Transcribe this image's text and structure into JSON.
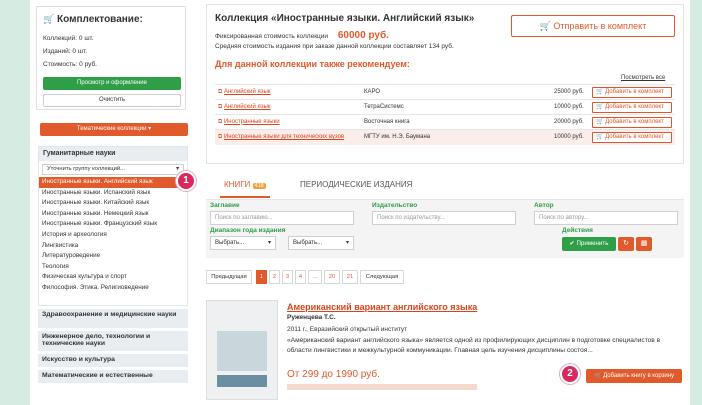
{
  "kit": {
    "title": "Комплектование:",
    "copies": "Коллекций: 0 шт.",
    "editions": "Изданий: 0 шт.",
    "cost": "Стоимость: 0 руб.",
    "view_button": "Просмотр и оформление",
    "clear_button": "Очистить"
  },
  "thematic_button": "Тематические коллекции",
  "humanities": {
    "title": "Гуманитарные науки",
    "refine_placeholder": "Уточнить группу коллекций...",
    "items": [
      "Иностранные языки. Английский язык",
      "Иностранные языки. Испанский язык",
      "Иностранные языки. Китайский язык",
      "Иностранные языки. Немецкий язык",
      "Иностранные языки. Французский язык",
      "История и археология",
      "Лингвистика",
      "Литературоведение",
      "Теология",
      "Физическая культура и спорт",
      "Философия. Этика. Религиоведение"
    ]
  },
  "sections": [
    "Здравоохранение и медицинские науки",
    "Инженерное дело, технологии и технические науки",
    "Искусство и культура",
    "Математические и естественные"
  ],
  "collection": {
    "title": "Коллекция «Иностранные языки. Английский язык»",
    "fixed_cost_label": "Фиксированная стоимость коллекции",
    "fixed_cost_value": "60000 руб.",
    "avg_cost": "Средняя стоимость издания при заказе данной коллекции составляет 134 руб.",
    "send_button": "Отправить в комплект",
    "recommend_title": "Для данной коллекции также рекомендуем:",
    "see_all": "Посмотреть все",
    "recommendations": [
      {
        "name": "Английский язык",
        "publisher": "КАРО",
        "price": "25000 руб.",
        "button": "Добавить в комплект"
      },
      {
        "name": "Английский язык",
        "publisher": "ТетраСистемс",
        "price": "10000 руб.",
        "button": "Добавить в комплект"
      },
      {
        "name": "Иностранные языки",
        "publisher": "Восточная книга",
        "price": "20000 руб.",
        "button": "Добавить в комплект"
      },
      {
        "name": "Иностранные языки для технических вузов",
        "publisher": "МГТУ им. Н.Э. Баумана",
        "price": "10000 руб.",
        "button": "Добавить в комплект"
      }
    ]
  },
  "tabs": {
    "books_label": "КНИГИ",
    "books_count": "418",
    "periodicals_label": "ПЕРИОДИЧЕСКИЕ ИЗДАНИЯ"
  },
  "filters": {
    "title_label": "Заглавие",
    "title_placeholder": "Поиск по заглавию...",
    "publisher_label": "Издательство",
    "publisher_placeholder": "Поиск по издательству...",
    "author_label": "Автор",
    "author_placeholder": "Поиск по автору...",
    "year_label": "Диапазон года издания",
    "year_from": "Выбрать...",
    "year_to": "Выбрать...",
    "actions_label": "Действия",
    "apply_button": "Применить"
  },
  "pagination": {
    "prev": "Предыдущая",
    "pages": [
      "1",
      "2",
      "3",
      "4",
      "...",
      "20",
      "21"
    ],
    "next": "Следующая"
  },
  "book": {
    "title": "Американский вариант английского языка",
    "author": "Руженцева Т.С.",
    "meta": "2011 г., Евразийский открытый институт",
    "description": "«Американский вариант английского языка» является одной из профилирующих дисциплин в подготовке специалистов в области лингвистики и межкультурной коммуникации. Главная цель изучения дисциплины состоя...",
    "price": "От 299 до 1990 руб.",
    "cart_button": "Добавить книгу в корзину"
  },
  "markers": [
    "1",
    "2"
  ],
  "colors": {
    "accent": "#e05a2b",
    "green": "#2e9e47",
    "badge": "#d7295d",
    "background": "#d6ebe1"
  }
}
